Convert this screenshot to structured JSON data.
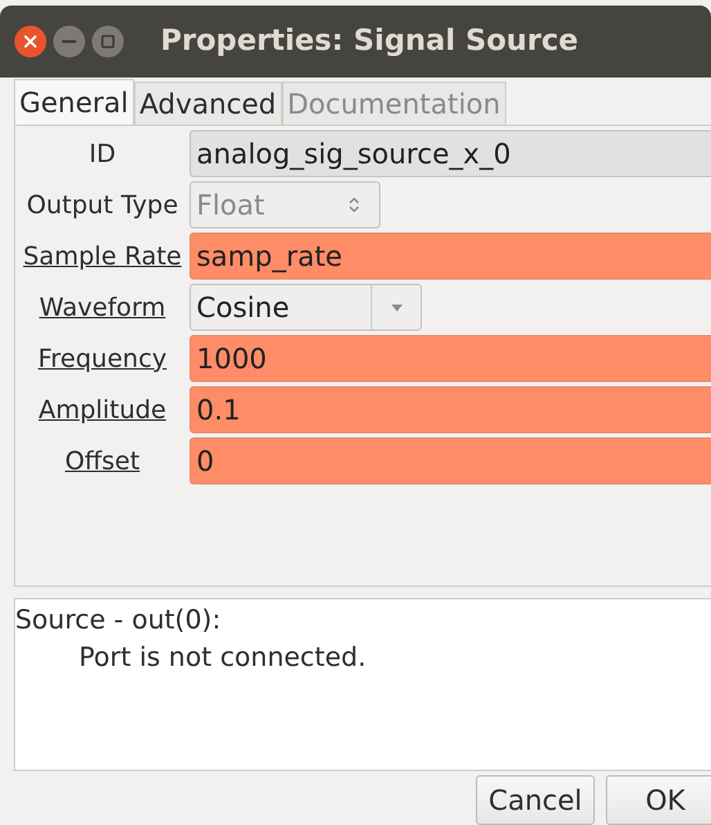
{
  "window": {
    "title": "Properties: Signal Source"
  },
  "tabs": [
    {
      "label": "General",
      "selected": true,
      "disabled": false
    },
    {
      "label": "Advanced",
      "selected": false,
      "disabled": false
    },
    {
      "label": "Documentation",
      "selected": false,
      "disabled": true
    }
  ],
  "params": [
    {
      "kind": "readonly",
      "label": "ID",
      "value": "analog_sig_source_x_0",
      "underlined": false,
      "dimmed": false
    },
    {
      "kind": "spinner",
      "label": "Output Type",
      "value": "Float",
      "underlined": false,
      "dimmed": true
    },
    {
      "kind": "entry",
      "label": "Sample Rate",
      "value": "samp_rate",
      "underlined": true,
      "invalid": true,
      "dimmed": false
    },
    {
      "kind": "dropdown",
      "label": "Waveform",
      "value": "Cosine",
      "underlined": true,
      "dimmed": false
    },
    {
      "kind": "entry",
      "label": "Frequency",
      "value": "1000",
      "underlined": true,
      "invalid": true,
      "dimmed": false
    },
    {
      "kind": "entry",
      "label": "Amplitude",
      "value": "0.1",
      "underlined": true,
      "invalid": true,
      "dimmed": false
    },
    {
      "kind": "entry",
      "label": "Offset",
      "value": "0",
      "underlined": true,
      "invalid": true,
      "dimmed": false
    }
  ],
  "messages": [
    "Source - out(0):",
    "Port is not connected."
  ],
  "buttons": [
    "Cancel",
    "OK"
  ]
}
